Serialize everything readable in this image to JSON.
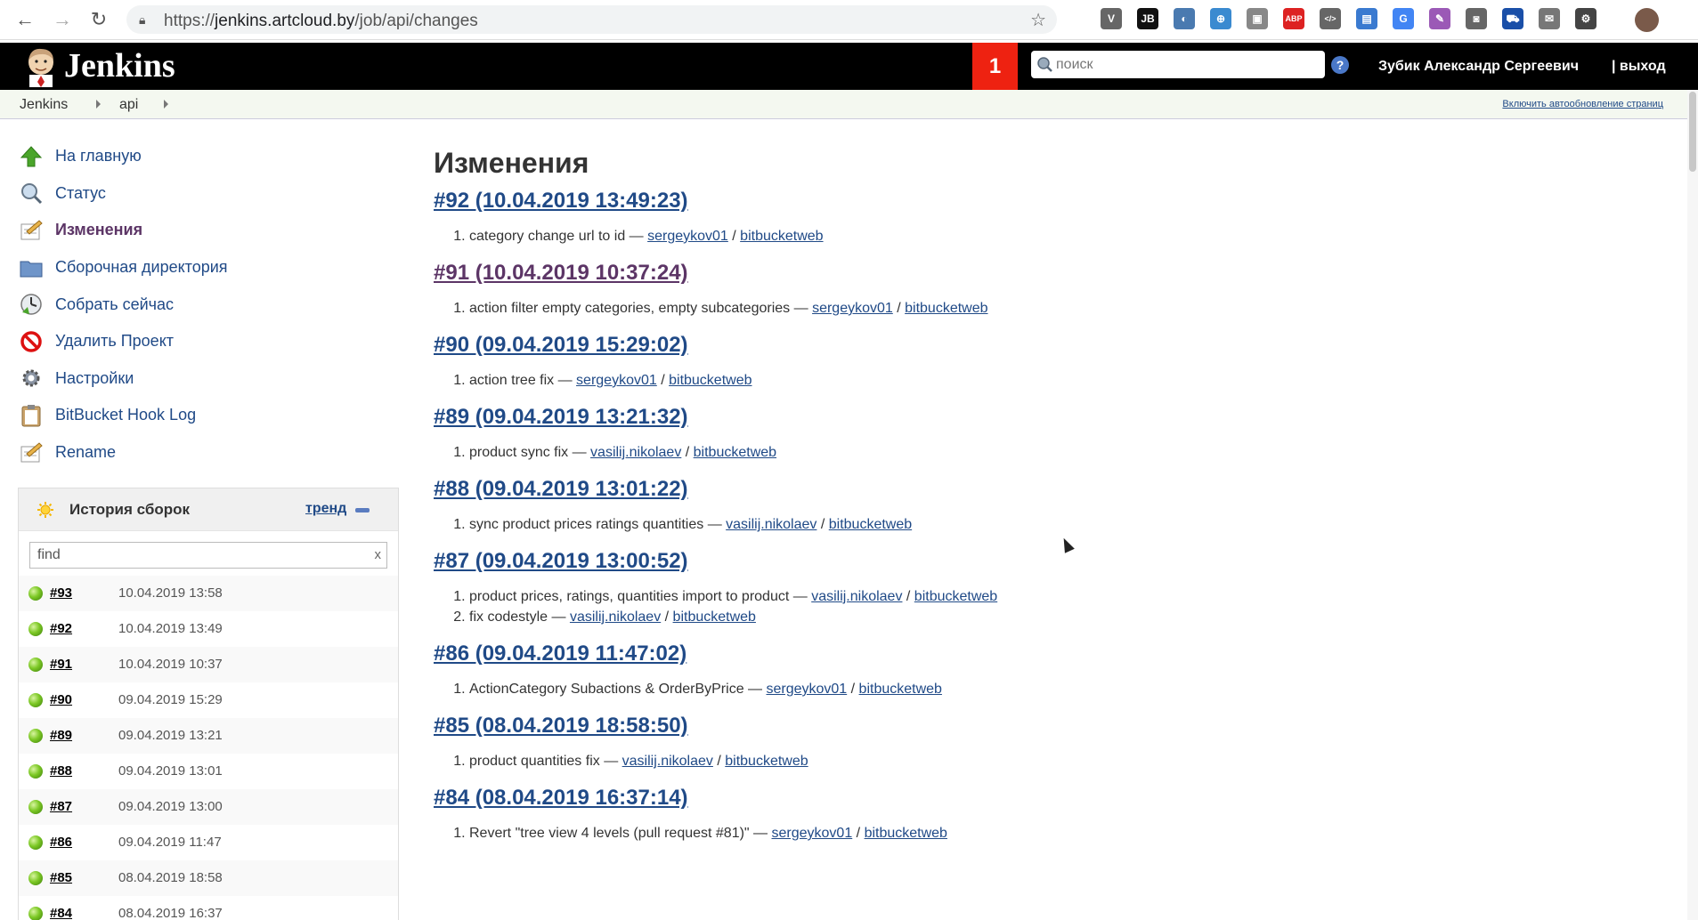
{
  "browser": {
    "url_prefix": "https://",
    "url_host": "jenkins.artcloud.by",
    "url_path": "/job/api/changes",
    "extensions": [
      {
        "name": "vimeo-icon",
        "label": "V",
        "color": "#666"
      },
      {
        "name": "jetbrains-icon",
        "label": "JB",
        "color": "#111"
      },
      {
        "name": "dev-icon",
        "label": "◐",
        "color": "#4a7ab0"
      },
      {
        "name": "translate-badge-icon",
        "label": "⊕",
        "color": "#3a8ad0"
      },
      {
        "name": "image-icon",
        "label": "▣",
        "color": "#888"
      },
      {
        "name": "abp-icon",
        "label": "ABP",
        "color": "#d22"
      },
      {
        "name": "code-icon",
        "label": "</>",
        "color": "#666"
      },
      {
        "name": "reader-icon",
        "label": "▤",
        "color": "#3a7ad0"
      },
      {
        "name": "google-translate-icon",
        "label": "G",
        "color": "#4285f4"
      },
      {
        "name": "pen-icon",
        "label": "✎",
        "color": "#9b59b6"
      },
      {
        "name": "camera-icon",
        "label": "◙",
        "color": "#666"
      },
      {
        "name": "cart-icon",
        "label": "⛟",
        "color": "#1a4fa8"
      },
      {
        "name": "mail-icon",
        "label": "✉",
        "color": "#777"
      },
      {
        "name": "settings-ext-icon",
        "label": "⚙",
        "color": "#444"
      }
    ]
  },
  "header": {
    "title": "Jenkins",
    "notifications": "1",
    "search_placeholder": "поиск",
    "help": "?",
    "user": "Зубик Александр Сергеевич",
    "logout": "| выход"
  },
  "breadcrumb": {
    "items": [
      "Jenkins",
      "api"
    ],
    "autorefresh": "Включить автообновление страниц"
  },
  "sidebar": {
    "tasks": [
      {
        "label": "На главную",
        "icon": "up-arrow-icon"
      },
      {
        "label": "Статус",
        "icon": "magnifier-icon"
      },
      {
        "label": "Изменения",
        "icon": "notepad-icon"
      },
      {
        "label": "Сборочная директория",
        "icon": "folder-icon"
      },
      {
        "label": "Собрать сейчас",
        "icon": "clock-icon"
      },
      {
        "label": "Удалить Проект",
        "icon": "no-entry-icon"
      },
      {
        "label": "Настройки",
        "icon": "gear-icon"
      },
      {
        "label": "BitBucket Hook Log",
        "icon": "clipboard-icon"
      },
      {
        "label": "Rename",
        "icon": "notepad-icon"
      }
    ]
  },
  "history": {
    "title": "История сборок",
    "trend": "тренд",
    "find_placeholder": "find",
    "clear": "x",
    "builds": [
      {
        "num": "#93",
        "time": "10.04.2019 13:58"
      },
      {
        "num": "#92",
        "time": "10.04.2019 13:49"
      },
      {
        "num": "#91",
        "time": "10.04.2019 10:37"
      },
      {
        "num": "#90",
        "time": "09.04.2019 15:29"
      },
      {
        "num": "#89",
        "time": "09.04.2019 13:21"
      },
      {
        "num": "#88",
        "time": "09.04.2019 13:01"
      },
      {
        "num": "#87",
        "time": "09.04.2019 13:00"
      },
      {
        "num": "#86",
        "time": "09.04.2019 11:47"
      },
      {
        "num": "#85",
        "time": "08.04.2019 18:58"
      },
      {
        "num": "#84",
        "time": "08.04.2019 16:37"
      }
    ]
  },
  "main": {
    "title": "Изменения",
    "changes": [
      {
        "title": "#92 (10.04.2019 13:49:23)",
        "entries": [
          {
            "msg": "category change url to id — ",
            "author": "sergeykov01",
            "repo": "bitbucketweb"
          }
        ]
      },
      {
        "title": "#91 (10.04.2019 10:37:24)",
        "visited": true,
        "entries": [
          {
            "msg": "action filter empty categories, empty subcategories — ",
            "author": "sergeykov01",
            "repo": "bitbucketweb"
          }
        ]
      },
      {
        "title": "#90 (09.04.2019 15:29:02)",
        "entries": [
          {
            "msg": "action tree fix — ",
            "author": "sergeykov01",
            "repo": "bitbucketweb"
          }
        ]
      },
      {
        "title": "#89 (09.04.2019 13:21:32)",
        "entries": [
          {
            "msg": "product sync fix — ",
            "author": "vasilij.nikolaev",
            "repo": "bitbucketweb"
          }
        ]
      },
      {
        "title": "#88 (09.04.2019 13:01:22)",
        "entries": [
          {
            "msg": "sync product prices ratings quantities — ",
            "author": "vasilij.nikolaev",
            "repo": "bitbucketweb"
          }
        ]
      },
      {
        "title": "#87 (09.04.2019 13:00:52)",
        "entries": [
          {
            "msg": "product prices, ratings, quantities import to product — ",
            "author": "vasilij.nikolaev",
            "repo": "bitbucketweb"
          },
          {
            "msg": "fix codestyle — ",
            "author": "vasilij.nikolaev",
            "repo": "bitbucketweb"
          }
        ]
      },
      {
        "title": "#86 (09.04.2019 11:47:02)",
        "entries": [
          {
            "msg": "ActionCategory Subactions & OrderByPrice — ",
            "author": "sergeykov01",
            "repo": "bitbucketweb"
          }
        ]
      },
      {
        "title": "#85 (08.04.2019 18:58:50)",
        "entries": [
          {
            "msg": "product quantities fix — ",
            "author": "vasilij.nikolaev",
            "repo": "bitbucketweb"
          }
        ]
      },
      {
        "title": "#84 (08.04.2019 16:37:14)",
        "entries": [
          {
            "msg": "Revert \"tree view 4 levels (pull request #81)\" — ",
            "author": "sergeykov01",
            "repo": "bitbucketweb"
          }
        ]
      }
    ]
  }
}
